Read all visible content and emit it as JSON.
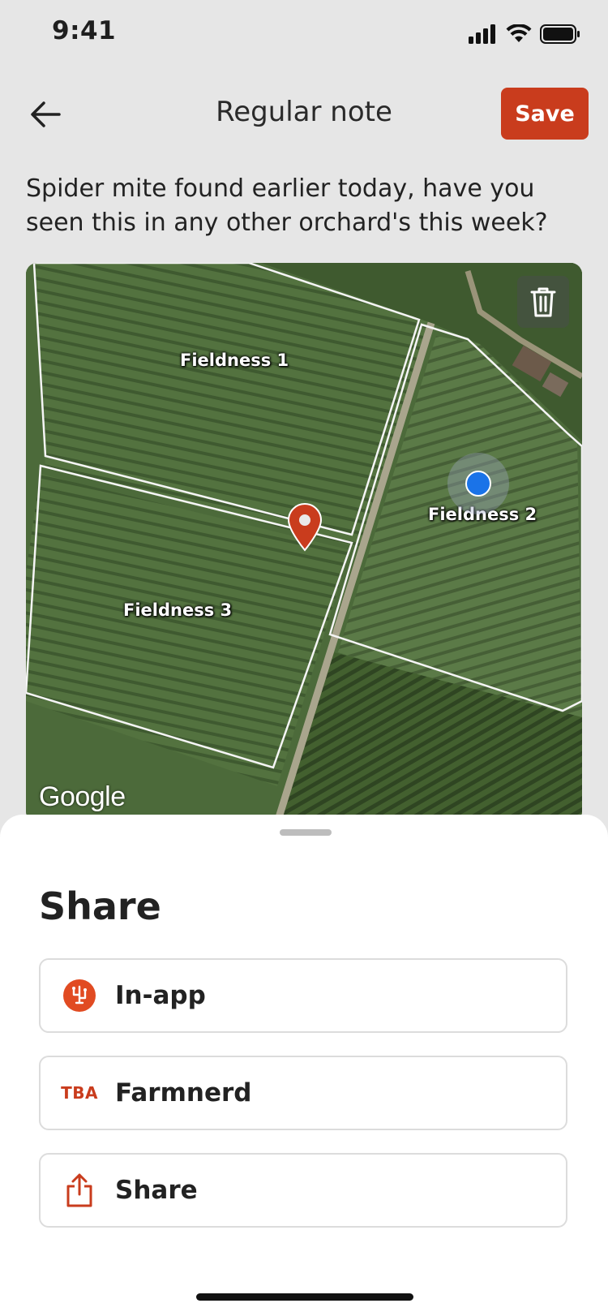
{
  "status_bar": {
    "time": "9:41"
  },
  "header": {
    "title": "Regular note",
    "save_label": "Save"
  },
  "note": {
    "text": "Spider mite found earlier today, have you seen this in any other orchard's this week?"
  },
  "map": {
    "fields": [
      "Fieldness 1",
      "Fieldness 2",
      "Fieldness 3"
    ],
    "attribution": "Google"
  },
  "share_sheet": {
    "title": "Share",
    "options": [
      {
        "label": "In-app",
        "icon": "in-app-icon"
      },
      {
        "label": "Farmnerd",
        "icon": "TBA"
      },
      {
        "label": "Share",
        "icon": "share-icon"
      }
    ]
  },
  "colors": {
    "accent": "#c93c1d",
    "location_dot": "#1a73e8"
  }
}
